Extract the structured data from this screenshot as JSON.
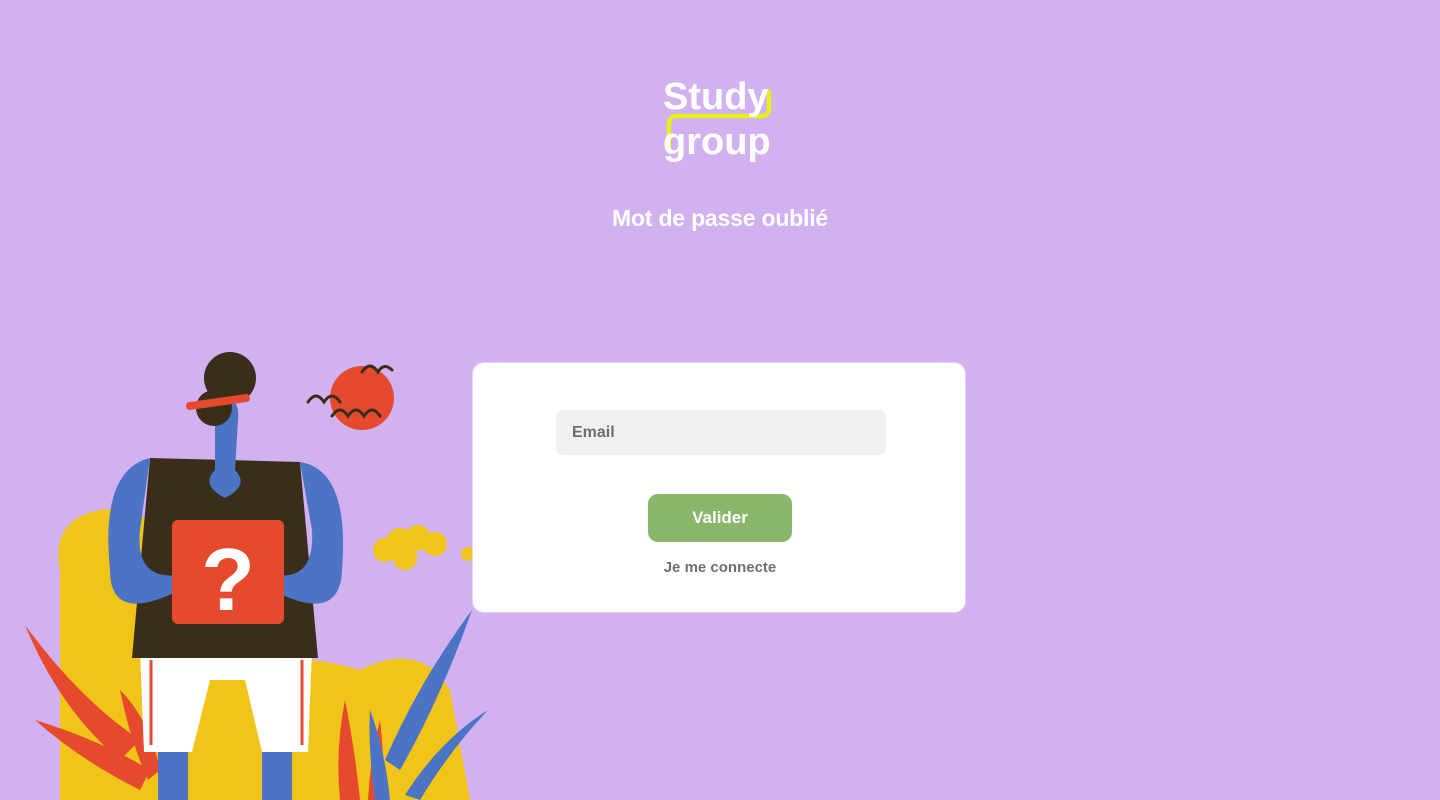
{
  "brand": {
    "logo_line1": "Study",
    "logo_line2": "group",
    "colors": {
      "background": "#d1b1f0",
      "accent_yellow": "#e5f21a",
      "button_green": "#8ab66b"
    }
  },
  "page_title": "Mot de passe oublié",
  "form": {
    "email_placeholder": "Email",
    "email_value": "",
    "submit_label": "Valider",
    "login_link_label": "Je me connecte"
  },
  "illustration": {
    "icons": [
      "person-with-question-sign-icon",
      "sun-icon",
      "birds-icon",
      "cloud-icon",
      "leaves-icon"
    ]
  }
}
